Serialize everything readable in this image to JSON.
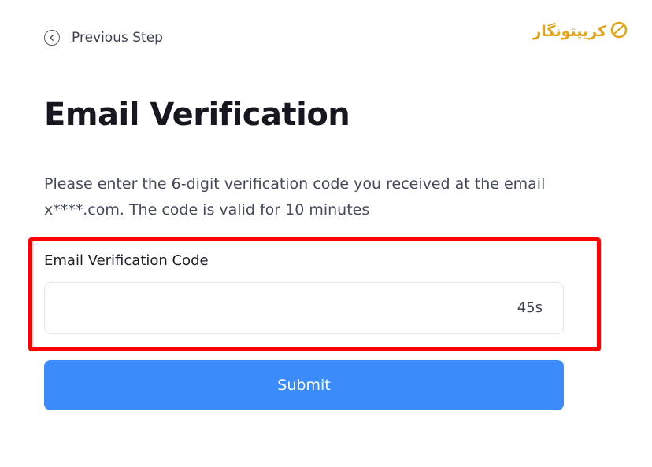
{
  "header": {
    "back_label": "Previous Step",
    "back_icon": "chevron-left-circle-icon"
  },
  "watermark": {
    "text": "کریپتونگار",
    "icon": "crypto-coin-icon",
    "color": "#e3a414"
  },
  "main": {
    "title": "Email Verification",
    "description": "Please enter the 6-digit verification code you received at the email x****.com. The code is valid for 10 minutes"
  },
  "form": {
    "field_label": "Email Verification Code",
    "code_value": "",
    "code_placeholder": "",
    "countdown": "45s",
    "submit_label": "Submit"
  },
  "colors": {
    "accent": "#3b8cfa",
    "highlight": "#ff0000"
  }
}
